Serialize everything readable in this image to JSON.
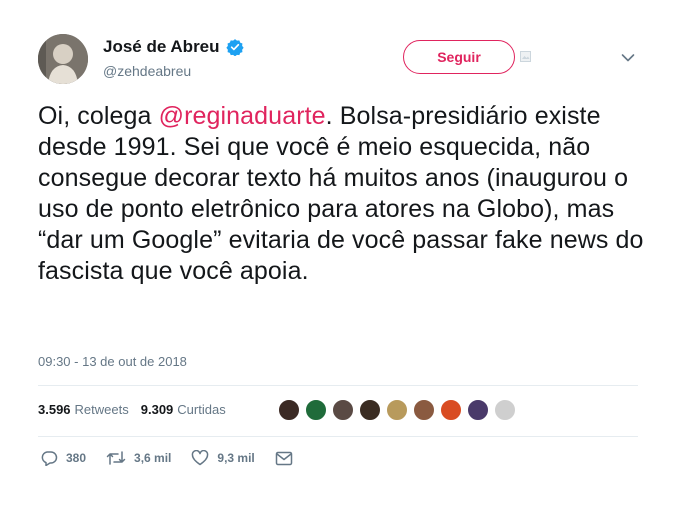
{
  "author": {
    "name": "José de Abreu",
    "handle": "@zehdeabreu"
  },
  "follow_button": {
    "label": "Seguir"
  },
  "tweet": {
    "before_mention": "Oi, colega ",
    "mention": "@reginaduarte",
    "after_mention": ". Bolsa-presidiário existe desde 1991. Sei que você é meio esquecida, não consegue decorar texto há muitos anos (inaugurou o uso de ponto eletrônico para atores na Globo), mas “dar um Google” evitaria de você passar fake news do fascista que você apoia.",
    "timestamp": "09:30 - 13 de out de 2018"
  },
  "stats": {
    "retweets_count": "3.596",
    "retweets_label": "Retweets",
    "likes_count": "9.309",
    "likes_label": "Curtidas"
  },
  "liker_avatars": [
    {
      "color": "#3b2a24"
    },
    {
      "color": "#1f6b3a"
    },
    {
      "color": "#5a4a44"
    },
    {
      "color": "#3a2c22"
    },
    {
      "color": "#b89a5c"
    },
    {
      "color": "#8a5a40"
    },
    {
      "color": "#d94c22"
    },
    {
      "color": "#4a3a6a"
    },
    {
      "color": "#cfcfcf"
    }
  ],
  "actions": {
    "replies": "380",
    "retweets": "3,6 mil",
    "likes": "9,3 mil"
  },
  "colors": {
    "accent": "#e0245e",
    "verified": "#1da1f2",
    "secondary_text": "#657786"
  }
}
